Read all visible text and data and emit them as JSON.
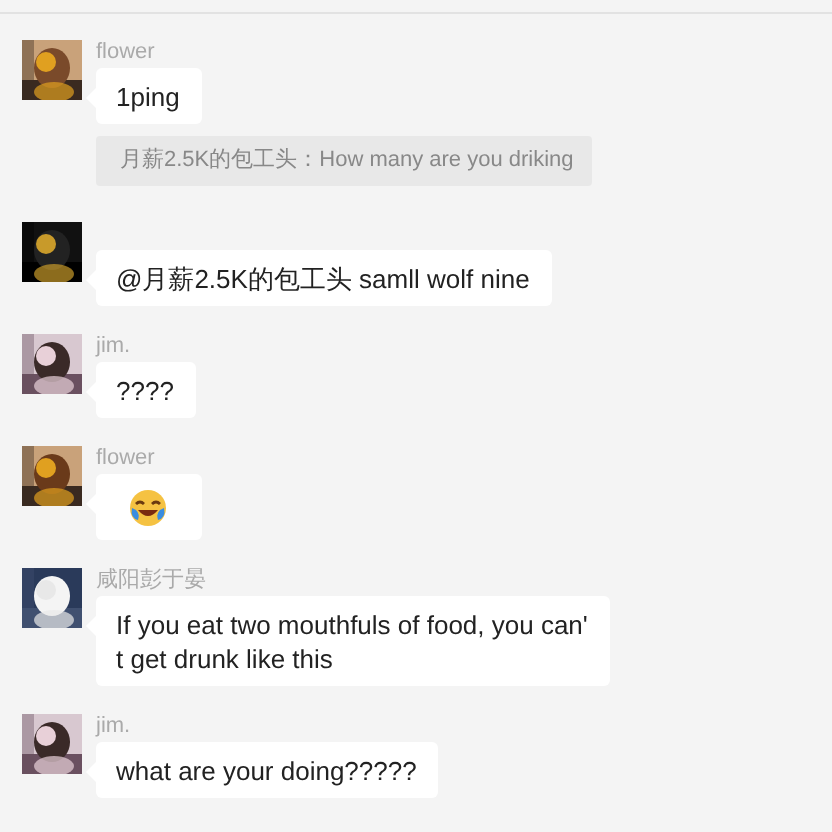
{
  "messages": [
    {
      "sender": "flower",
      "kind": "text",
      "body": "1ping",
      "quote": "月薪2.5K的包工头：How many are you driking"
    },
    {
      "kind": "text",
      "body": "@月薪2.5K的包工头 samll wolf nine"
    },
    {
      "sender": "jim.",
      "kind": "text",
      "body": "????"
    },
    {
      "sender": "flower",
      "kind": "emoji"
    },
    {
      "sender": "咸阳彭于晏",
      "kind": "text",
      "body": "If you eat two mouthfuls of food, you can' t get drunk like this"
    },
    {
      "sender": "jim.",
      "kind": "text",
      "body": "what are your doing?????"
    }
  ]
}
